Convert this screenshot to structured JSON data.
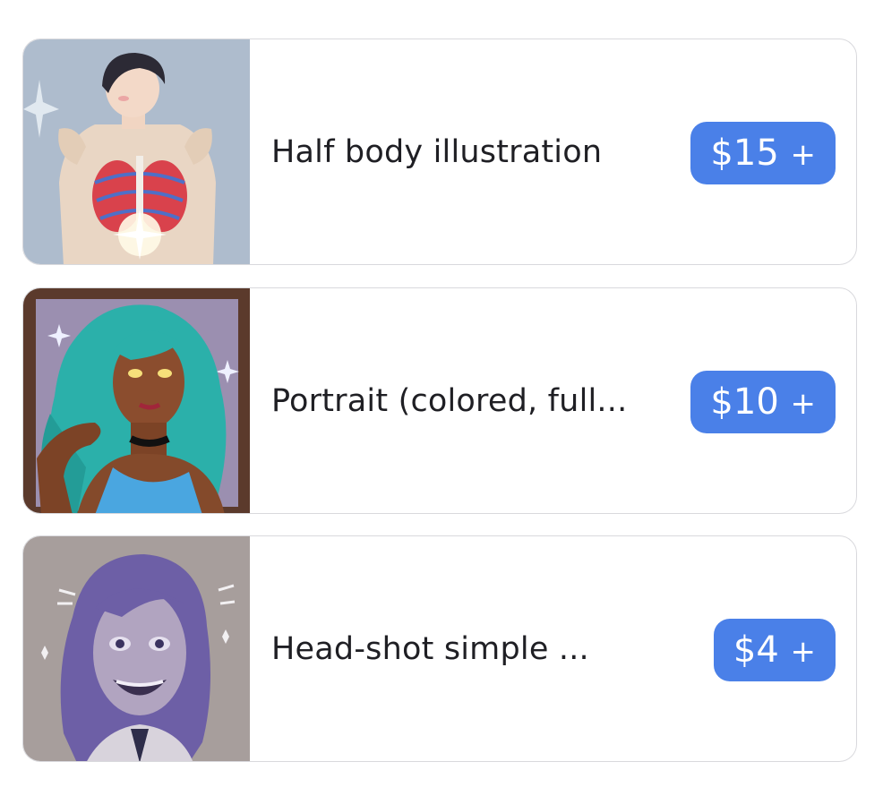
{
  "items": [
    {
      "title": "Half body illustration",
      "price": "$15",
      "plus": "+",
      "thumbnail_icon": "illustration-thumbnail"
    },
    {
      "title": "Portrait (colored, full...",
      "price": "$10",
      "plus": "+",
      "thumbnail_icon": "illustration-thumbnail"
    },
    {
      "title": "Head-shot simple ...",
      "price": "$4",
      "plus": "+",
      "thumbnail_icon": "illustration-thumbnail"
    }
  ],
  "colors": {
    "accent": "#4a80e8",
    "card_border": "#d9d9dd",
    "title_text": "#1f1f24"
  }
}
